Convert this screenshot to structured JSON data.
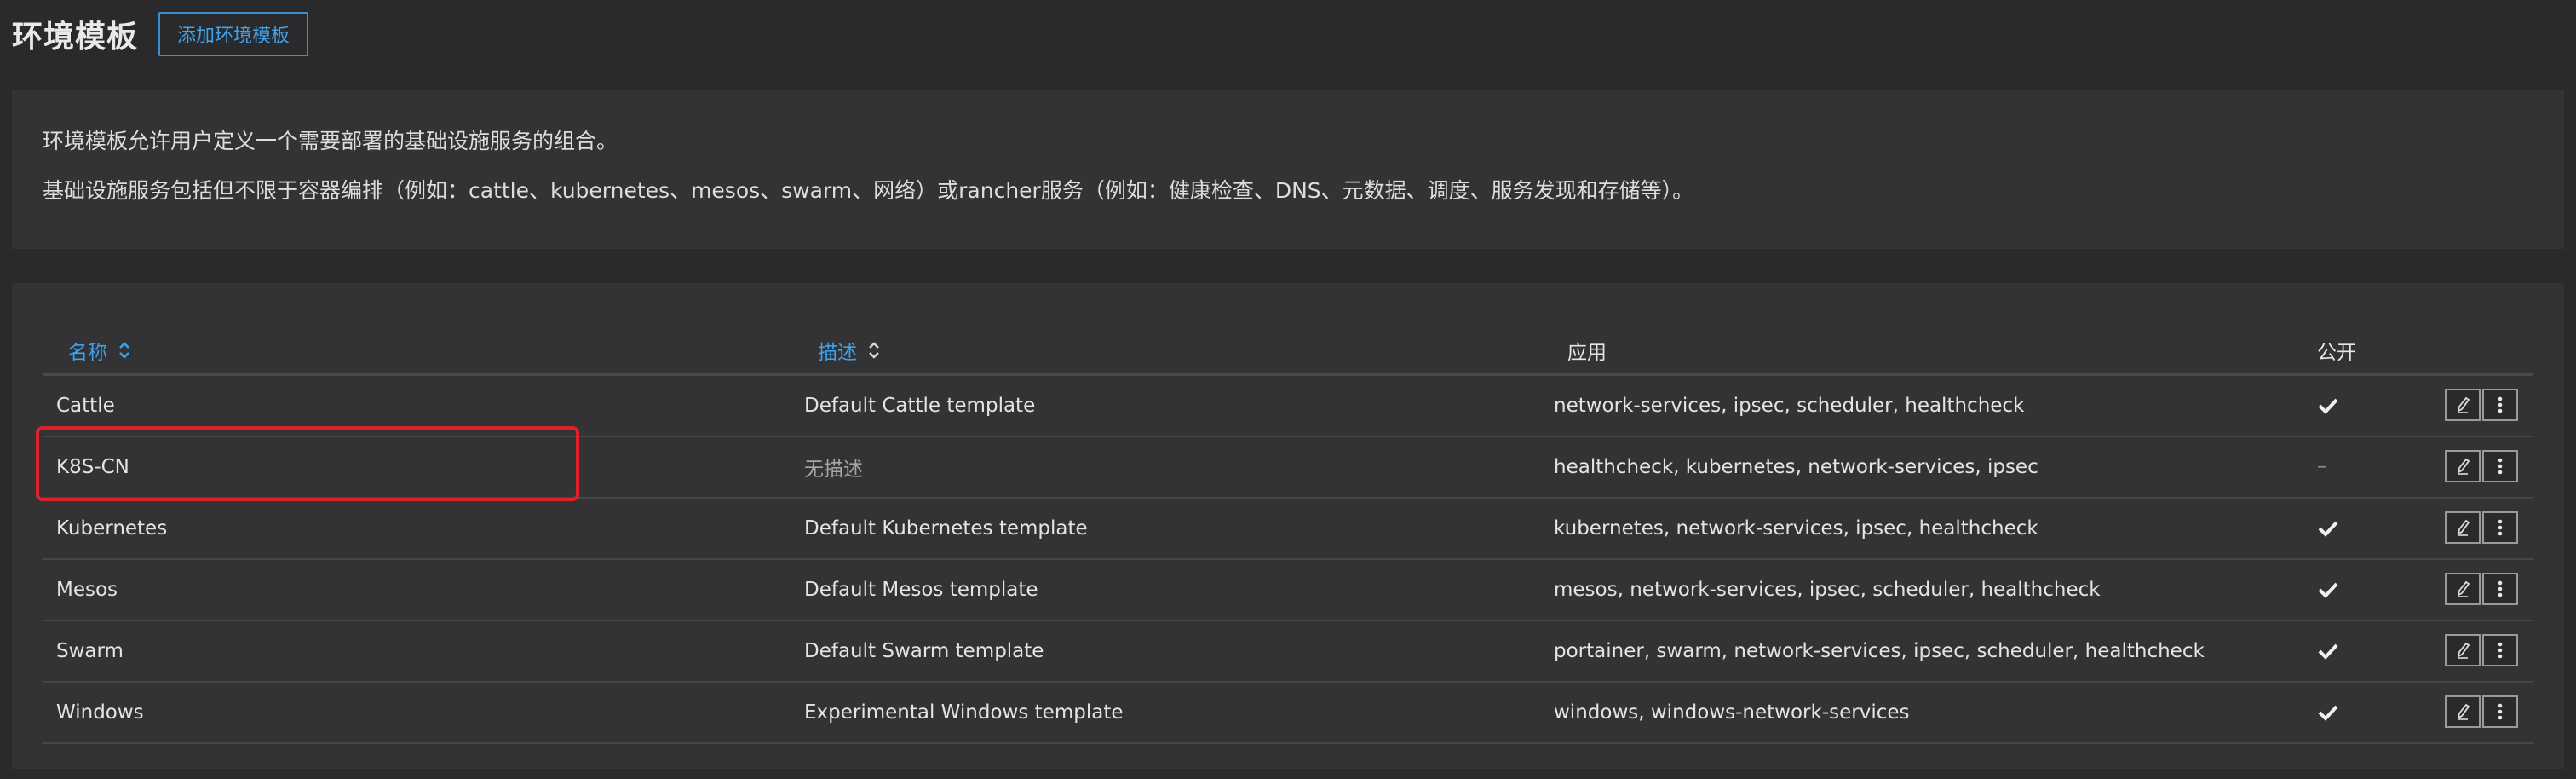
{
  "header": {
    "title": "环境模板",
    "add_button_label": "添加环境模板"
  },
  "info": {
    "line1": "环境模板允许用户定义一个需要部署的基础设施服务的组合。",
    "line2": "基础设施服务包括但不限于容器编排（例如：cattle、kubernetes、mesos、swarm、网络）或rancher服务（例如：健康检查、DNS、元数据、调度、服务发现和存储等）。"
  },
  "table": {
    "columns": {
      "name": "名称",
      "description": "描述",
      "apps": "应用",
      "public": "公开"
    },
    "rows": [
      {
        "name": "Cattle",
        "description": "Default Cattle template",
        "apps": "network-services, ipsec, scheduler, healthcheck",
        "public": true
      },
      {
        "name": "K8S-CN",
        "description": "无描述",
        "apps": "healthcheck, kubernetes, network-services, ipsec",
        "public": false,
        "public_text": "–"
      },
      {
        "name": "Kubernetes",
        "description": "Default Kubernetes template",
        "apps": "kubernetes, network-services, ipsec, healthcheck",
        "public": true
      },
      {
        "name": "Mesos",
        "description": "Default Mesos template",
        "apps": "mesos, network-services, ipsec, scheduler, healthcheck",
        "public": true
      },
      {
        "name": "Swarm",
        "description": "Default Swarm template",
        "apps": "portainer, swarm, network-services, ipsec, scheduler, healthcheck",
        "public": true
      },
      {
        "name": "Windows",
        "description": "Experimental Windows template",
        "apps": "windows, windows-network-services",
        "public": true
      }
    ]
  },
  "icons": {
    "sort": "sort-icon",
    "check": "check-icon",
    "edit": "pencil-icon",
    "more": "more-vertical-icon"
  },
  "colors": {
    "accent": "#3ea3ec",
    "highlight": "#e0202a",
    "background": "#2a2a2c",
    "panel": "#333335"
  }
}
